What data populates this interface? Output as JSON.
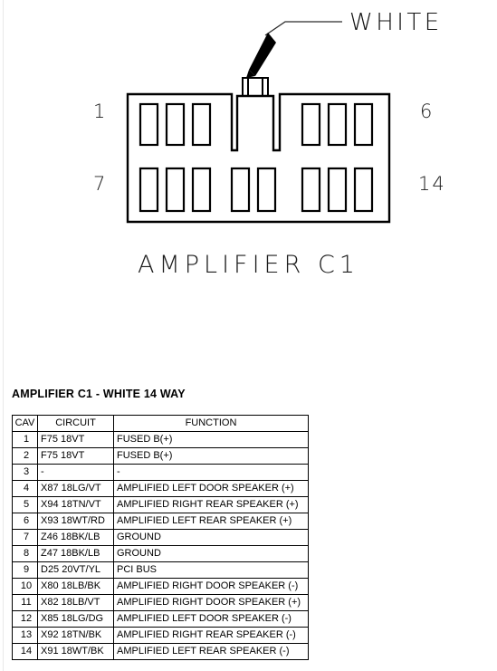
{
  "diagram": {
    "callout_label": "WHITE",
    "callout_icon": "arrow-pointer-icon",
    "caption": "AMPLIFIER C1",
    "pin_markers": {
      "top_left": "1",
      "top_right": "6",
      "bottom_left": "7",
      "bottom_right": "14"
    },
    "connector": {
      "top_row_cavities": 6,
      "bottom_row_cavities": 8,
      "locking_tab": "center-top",
      "line_color": "#000000",
      "fill_color": "#ffffff"
    }
  },
  "table": {
    "title": "AMPLIFIER C1 - WHITE 14 WAY",
    "headers": [
      "CAV",
      "CIRCUIT",
      "FUNCTION"
    ],
    "rows": [
      {
        "cav": "1",
        "circuit": "F75 18VT",
        "function": "FUSED B(+)"
      },
      {
        "cav": "2",
        "circuit": "F75 18VT",
        "function": "FUSED B(+)"
      },
      {
        "cav": "3",
        "circuit": "-",
        "function": "-"
      },
      {
        "cav": "4",
        "circuit": "X87 18LG/VT",
        "function": "AMPLIFIED LEFT DOOR SPEAKER (+)"
      },
      {
        "cav": "5",
        "circuit": "X94 18TN/VT",
        "function": "AMPLIFIED RIGHT REAR SPEAKER (+)"
      },
      {
        "cav": "6",
        "circuit": "X93 18WT/RD",
        "function": "AMPLIFIED LEFT REAR SPEAKER (+)"
      },
      {
        "cav": "7",
        "circuit": "Z46 18BK/LB",
        "function": "GROUND"
      },
      {
        "cav": "8",
        "circuit": "Z47 18BK/LB",
        "function": "GROUND"
      },
      {
        "cav": "9",
        "circuit": "D25 20VT/YL",
        "function": "PCI BUS"
      },
      {
        "cav": "10",
        "circuit": "X80 18LB/BK",
        "function": "AMPLIFIED RIGHT DOOR SPEAKER (-)"
      },
      {
        "cav": "11",
        "circuit": "X82 18LB/VT",
        "function": "AMPLIFIED RIGHT DOOR SPEAKER (+)"
      },
      {
        "cav": "12",
        "circuit": "X85 18LG/DG",
        "function": "AMPLIFIED LEFT DOOR SPEAKER (-)"
      },
      {
        "cav": "13",
        "circuit": "X92 18TN/BK",
        "function": "AMPLIFIED RIGHT REAR SPEAKER (-)"
      },
      {
        "cav": "14",
        "circuit": "X91 18WT/BK",
        "function": "AMPLIFIED LEFT REAR SPEAKER (-)"
      }
    ]
  }
}
